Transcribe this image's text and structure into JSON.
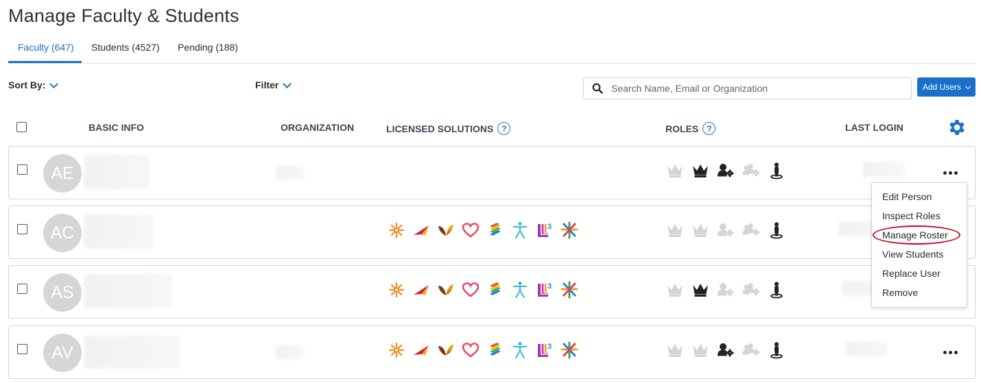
{
  "page": {
    "title": "Manage Faculty & Students"
  },
  "tabs": [
    {
      "label": "Faculty (647)",
      "active": true
    },
    {
      "label": "Students (4527)",
      "active": false
    },
    {
      "label": "Pending (188)",
      "active": false
    }
  ],
  "toolbar": {
    "sort_label": "Sort By:",
    "filter_label": "Filter",
    "search_placeholder": "Search Name, Email or Organization",
    "add_users_label": "Add Users"
  },
  "table": {
    "columns": {
      "basic_info": "BASIC INFO",
      "organization": "ORGANIZATION",
      "licensed_solutions": "LICENSED SOLUTIONS",
      "roles": "ROLES",
      "last_login": "LAST LOGIN"
    },
    "help_glyph": "?",
    "rows": [
      {
        "initials": "AE"
      },
      {
        "initials": "AC"
      },
      {
        "initials": "AS"
      },
      {
        "initials": "AV"
      }
    ]
  },
  "row_menu": {
    "items": [
      {
        "label": "Edit Person"
      },
      {
        "label": "Inspect Roles"
      },
      {
        "label": "Manage Roster",
        "highlighted": true
      },
      {
        "label": "View Students"
      },
      {
        "label": "Replace User"
      },
      {
        "label": "Remove"
      }
    ]
  },
  "colors": {
    "accent": "#1a6fc9",
    "highlight_ring": "#d0021b",
    "avatar_bg": "#d6d6d6",
    "role_active": "#222222",
    "role_inactive": "#d4d4d4"
  },
  "icons": {
    "solutions": [
      "snowflake-icon",
      "arrow-wing-icon",
      "leaf-wings-icon",
      "heart-icon",
      "book-stack-icon",
      "person-figure-icon",
      "l3-logo-icon",
      "cross-star-icon"
    ],
    "roles": [
      "crown-outline-icon",
      "crown-icon",
      "user-gear-icon",
      "group-gear-icon",
      "person-pin-icon"
    ]
  }
}
